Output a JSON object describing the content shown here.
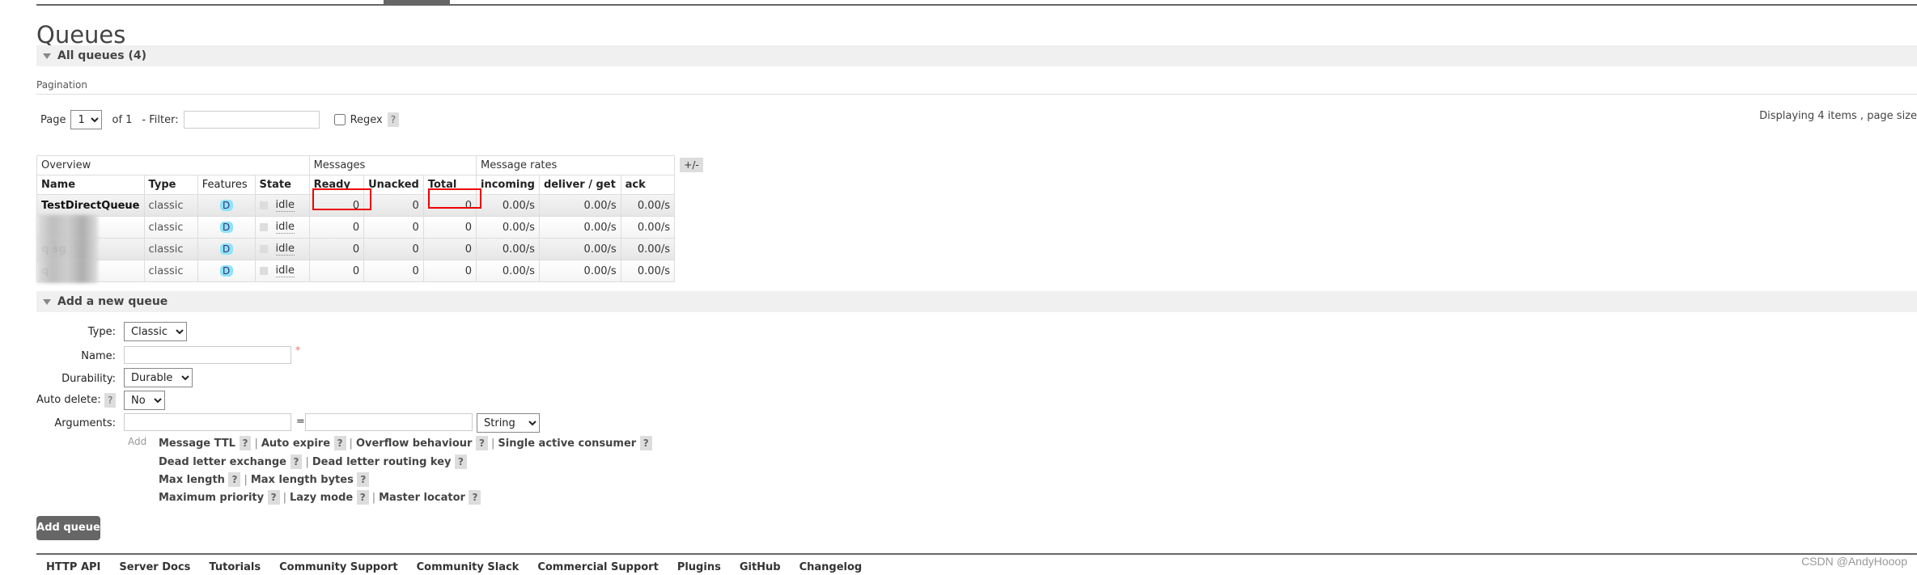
{
  "page_title": "Queues",
  "all_queues": {
    "label": "All queues (4)"
  },
  "pagination": {
    "label": "Pagination",
    "page_label": "Page",
    "page_value": "1",
    "of_label": "of 1",
    "filter_label": "- Filter:",
    "filter_value": "",
    "regex_label": "Regex",
    "help": "?",
    "displaying": "Displaying 4 items , page size"
  },
  "table": {
    "groups": [
      "Overview",
      "Messages",
      "Message rates"
    ],
    "columns": [
      "Name",
      "Type",
      "Features",
      "State",
      "Ready",
      "Unacked",
      "Total",
      "incoming",
      "deliver / get",
      "ack"
    ],
    "toggle": "+/-",
    "rows": [
      {
        "name": "TestDirectQueue",
        "type": "classic",
        "feature": "D",
        "state": "idle",
        "ready": "0",
        "unacked": "0",
        "total": "0",
        "incoming": "0.00/s",
        "deliver": "0.00/s",
        "ack": "0.00/s"
      },
      {
        "name": "",
        "type": "classic",
        "feature": "D",
        "state": "idle",
        "ready": "0",
        "unacked": "0",
        "total": "0",
        "incoming": "0.00/s",
        "deliver": "0.00/s",
        "ack": "0.00/s"
      },
      {
        "name": "q        sg",
        "type": "classic",
        "feature": "D",
        "state": "idle",
        "ready": "0",
        "unacked": "0",
        "total": "0",
        "incoming": "0.00/s",
        "deliver": "0.00/s",
        "ack": "0.00/s"
      },
      {
        "name": "q",
        "type": "classic",
        "feature": "D",
        "state": "idle",
        "ready": "0",
        "unacked": "0",
        "total": "0",
        "incoming": "0.00/s",
        "deliver": "0.00/s",
        "ack": "0.00/s"
      }
    ],
    "highlight_color": "#e00000"
  },
  "add_queue": {
    "section_label": "Add a new queue",
    "type_label": "Type:",
    "type_value": "Classic",
    "name_label": "Name:",
    "name_value": "",
    "required_mark": "*",
    "durability_label": "Durability:",
    "durability_value": "Durable",
    "auto_delete_label": "Auto delete:",
    "auto_delete_value": "No",
    "arguments_label": "Arguments:",
    "arg_key": "",
    "equals": "=",
    "arg_value": "",
    "arg_type": "String",
    "add_label": "Add",
    "arg_links": [
      [
        "Message TTL",
        "Auto expire",
        "Overflow behaviour",
        "Single active consumer"
      ],
      [
        "Dead letter exchange",
        "Dead letter routing key"
      ],
      [
        "Max length",
        "Max length bytes"
      ],
      [
        "Maximum priority",
        "Lazy mode",
        "Master locator"
      ]
    ],
    "submit_label": "Add queue"
  },
  "footer": [
    "HTTP API",
    "Server Docs",
    "Tutorials",
    "Community Support",
    "Community Slack",
    "Commercial Support",
    "Plugins",
    "GitHub",
    "Changelog"
  ],
  "watermark": "CSDN @AndyHooop"
}
